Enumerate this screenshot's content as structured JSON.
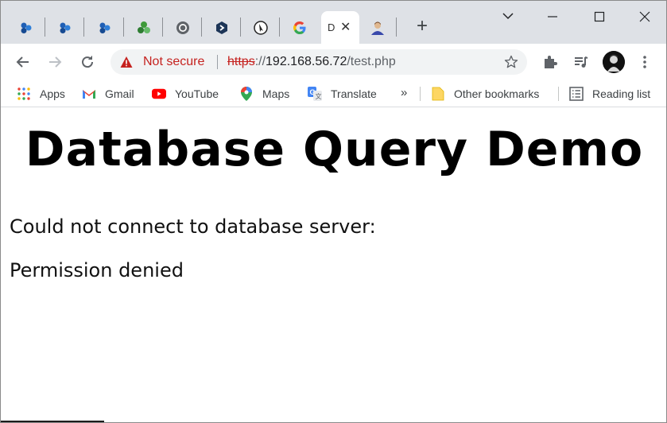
{
  "tabs": [
    {
      "icon": "hexagon-cluster-icon"
    },
    {
      "icon": "hexagon-cluster-icon"
    },
    {
      "icon": "hexagon-cluster-icon"
    },
    {
      "icon": "green-recycle-icon"
    },
    {
      "icon": "chrome-icon"
    },
    {
      "icon": "dark-shield-icon"
    },
    {
      "icon": "cursor-logo-icon"
    },
    {
      "icon": "google-g-icon"
    },
    {
      "icon": "document-icon",
      "title": "D",
      "active": true
    },
    {
      "icon": "person-avatar-icon"
    }
  ],
  "toolbar": {
    "security_label": "Not secure",
    "url_scheme": "https",
    "url_sep": "://",
    "url_host": "192.168.56.72",
    "url_path": "/test.php"
  },
  "bookmarks": {
    "items": [
      {
        "label": "Apps",
        "icon": "apps-grid-icon"
      },
      {
        "label": "Gmail",
        "icon": "gmail-icon"
      },
      {
        "label": "YouTube",
        "icon": "youtube-icon"
      },
      {
        "label": "Maps",
        "icon": "maps-pin-icon"
      },
      {
        "label": "Translate",
        "icon": "translate-icon"
      }
    ],
    "overflow": "»",
    "other": "Other bookmarks",
    "reading_list": "Reading list"
  },
  "page": {
    "title": "Database Query Demo",
    "message1": "Could not connect to database server:",
    "message2": "Permission denied"
  },
  "colors": {
    "tabstrip": "#dee1e6",
    "not_secure": "#c5221f",
    "omnibox": "#f1f3f4"
  }
}
